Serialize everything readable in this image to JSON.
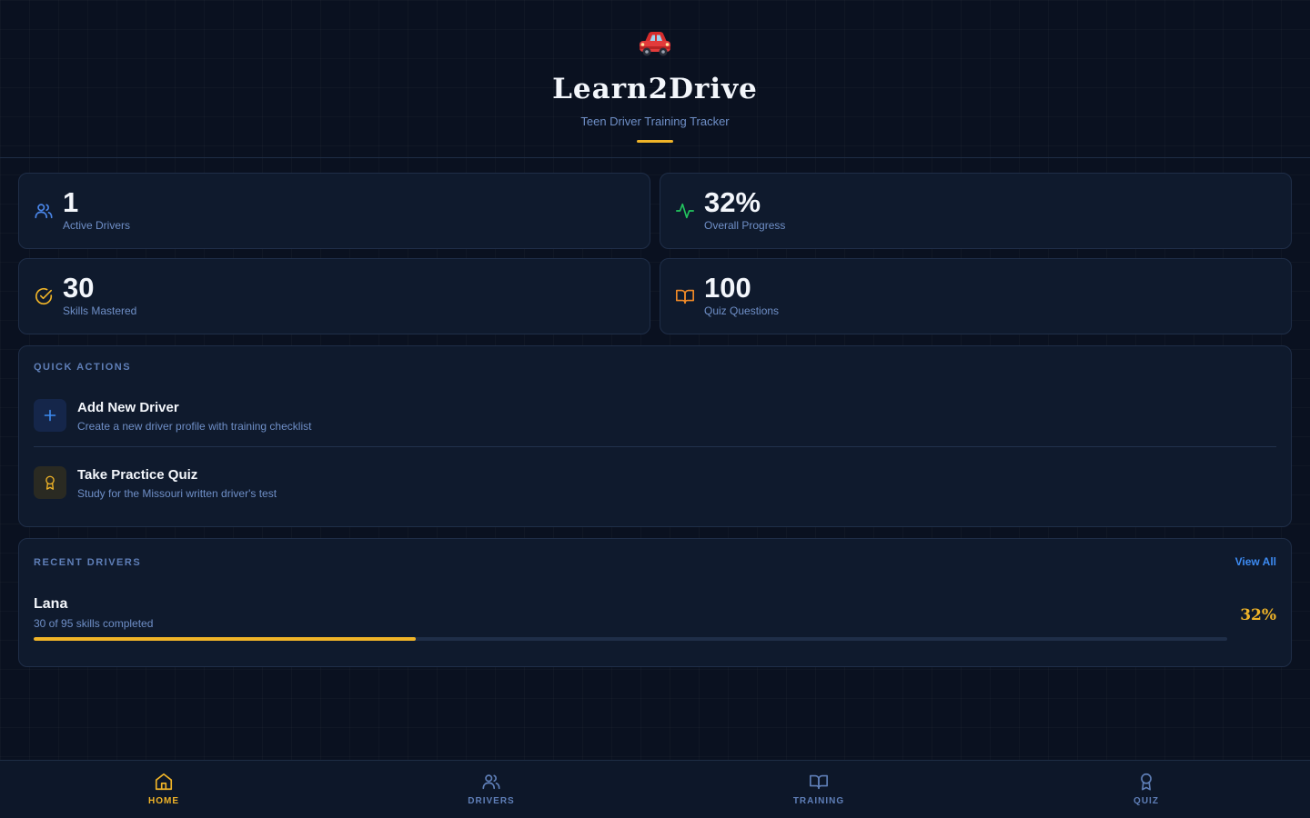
{
  "header": {
    "logo_icon": "car-icon",
    "title": "Learn2Drive",
    "subtitle": "Teen Driver Training Tracker"
  },
  "stats": [
    {
      "value": "1",
      "label": "Active Drivers",
      "icon": "users-icon",
      "color": "#4a86e8"
    },
    {
      "value": "32%",
      "label": "Overall Progress",
      "icon": "activity-icon",
      "color": "#22c55e"
    },
    {
      "value": "30",
      "label": "Skills Mastered",
      "icon": "check-circle-icon",
      "color": "#f0b428"
    },
    {
      "value": "100",
      "label": "Quiz Questions",
      "icon": "book-open-icon",
      "color": "#f08a28"
    }
  ],
  "quick_actions": {
    "title": "QUICK ACTIONS",
    "items": [
      {
        "title": "Add New Driver",
        "description": "Create a new driver profile with training checklist",
        "icon": "plus-icon"
      },
      {
        "title": "Take Practice Quiz",
        "description": "Study for the Missouri written driver's test",
        "icon": "award-icon"
      }
    ]
  },
  "recent_drivers": {
    "title": "RECENT DRIVERS",
    "view_all_label": "View All",
    "drivers": [
      {
        "name": "Lana",
        "detail": "30 of 95 skills completed",
        "percent_label": "32%",
        "progress": 0.32
      }
    ]
  },
  "nav": {
    "items": [
      {
        "label": "HOME",
        "icon": "home-icon",
        "active": true
      },
      {
        "label": "DRIVERS",
        "icon": "users-icon",
        "active": false
      },
      {
        "label": "TRAINING",
        "icon": "book-open-icon",
        "active": false
      },
      {
        "label": "QUIZ",
        "icon": "award-icon",
        "active": false
      }
    ]
  },
  "colors": {
    "accent": "#f0b428",
    "link": "#3d8bf2",
    "background": "#0a1120",
    "card": "#0f1a2d"
  }
}
